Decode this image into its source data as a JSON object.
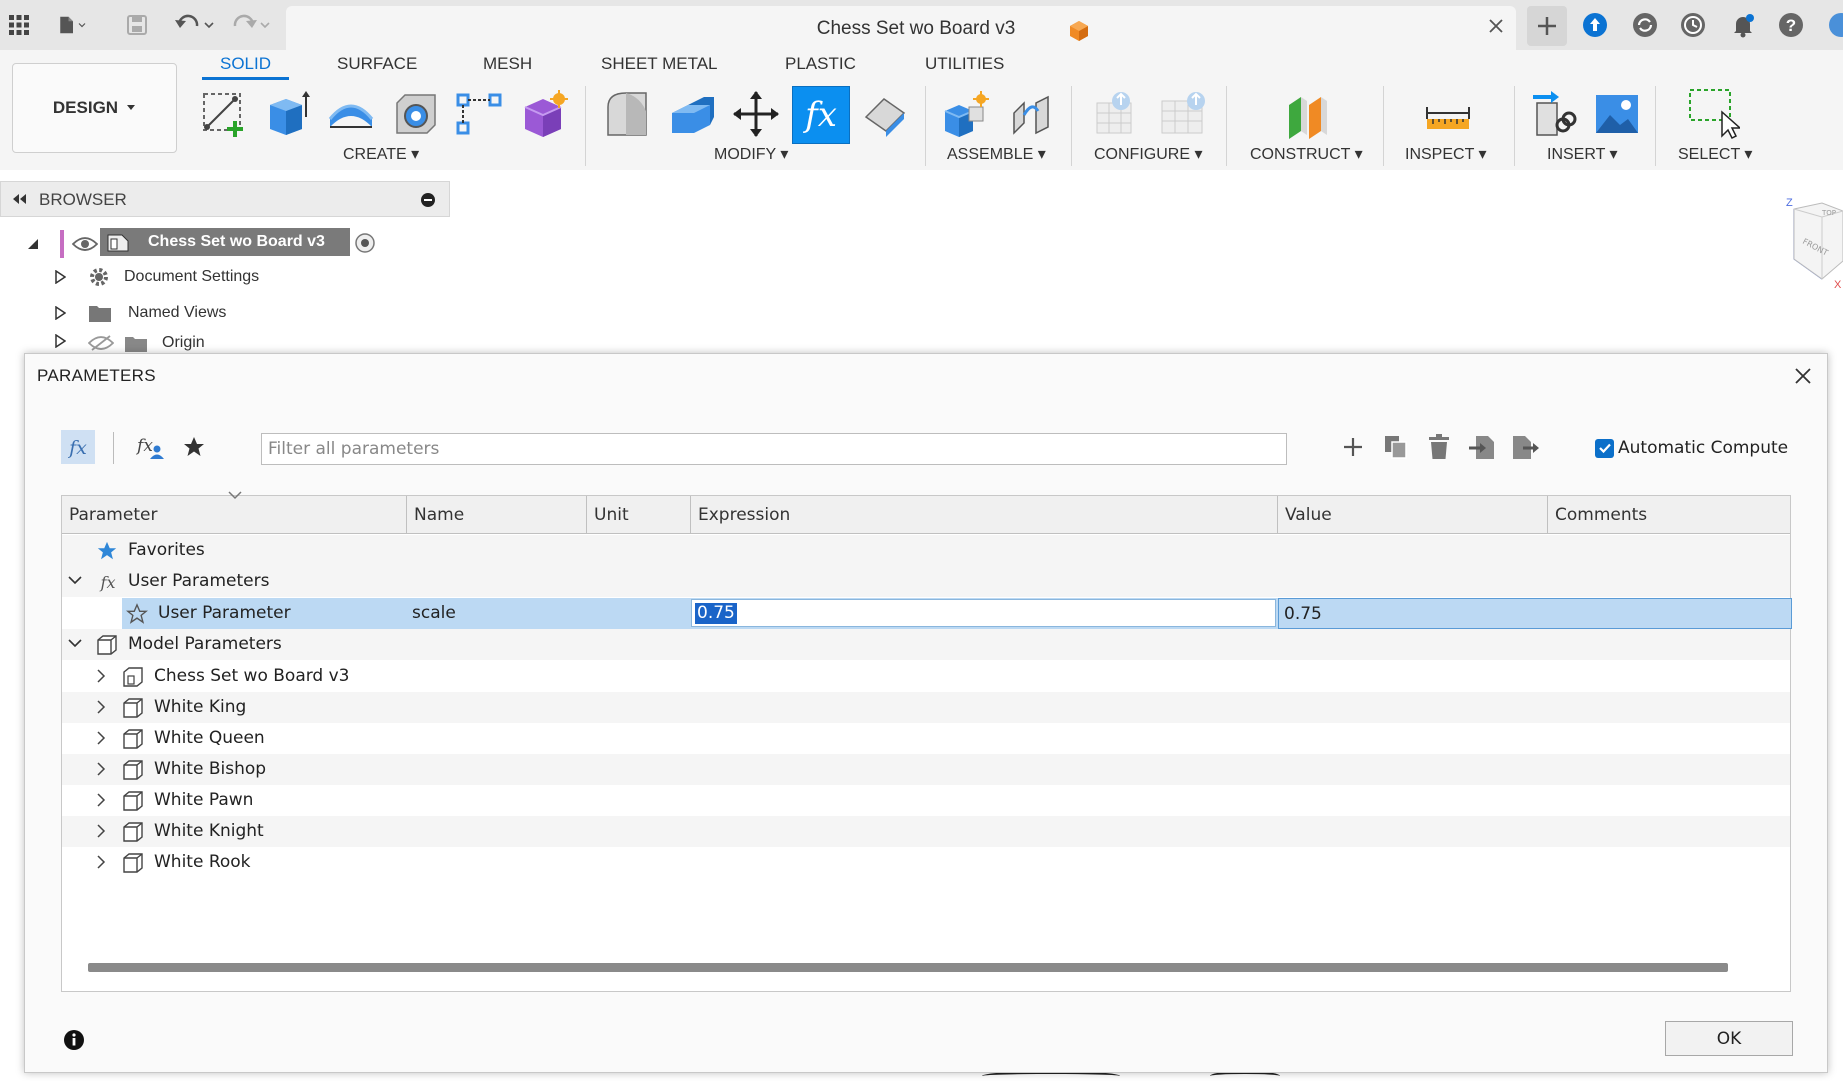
{
  "titlebar": {
    "document_title": "Chess Set wo Board v3"
  },
  "toolbar": {
    "workspace": "DESIGN",
    "tabs": [
      "SOLID",
      "SURFACE",
      "MESH",
      "SHEET METAL",
      "PLASTIC",
      "UTILITIES"
    ],
    "groups": [
      "CREATE",
      "MODIFY",
      "ASSEMBLE",
      "CONFIGURE",
      "CONSTRUCT",
      "INSPECT",
      "INSERT",
      "SELECT"
    ]
  },
  "browser": {
    "title": "BROWSER",
    "root": "Chess Set wo Board v3",
    "items": [
      "Document Settings",
      "Named Views",
      "Origin"
    ]
  },
  "viewcube": {
    "z_label": "Z",
    "x_label": "X"
  },
  "dialog": {
    "title": "PARAMETERS",
    "filter_placeholder": "Filter all parameters",
    "auto_compute_label": "Automatic Compute",
    "auto_compute_checked": true,
    "columns": [
      "Parameter",
      "Name",
      "Unit",
      "Expression",
      "Value",
      "Comments"
    ],
    "favorites_label": "Favorites",
    "user_params_label": "User Parameters",
    "user_param": {
      "parameter": "User Parameter",
      "name": "scale",
      "unit": "",
      "expression": "0.75",
      "value": "0.75",
      "comments": ""
    },
    "model_params_label": "Model Parameters",
    "model_components": [
      "Chess Set wo Board v3",
      "White King",
      "White Queen",
      "White Bishop",
      "White Pawn",
      "White Knight",
      "White Rook"
    ],
    "ok_label": "OK"
  },
  "colors": {
    "accent": "#0b73d3",
    "selection": "#bcd9f3",
    "text_selection": "#1a64c8"
  }
}
